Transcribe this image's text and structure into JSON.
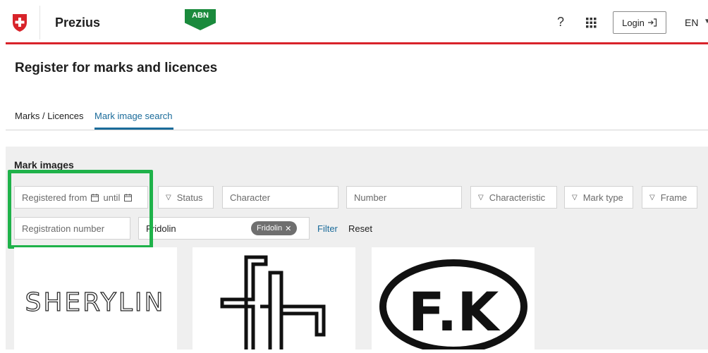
{
  "header": {
    "app_name": "Prezius",
    "env_badge": "ABN",
    "help_label": "?",
    "login_label": "Login",
    "language": "EN"
  },
  "page": {
    "title": "Register for marks and licences",
    "tabs": [
      {
        "label": "Marks / Licences",
        "active": false
      },
      {
        "label": "Mark image search",
        "active": true
      }
    ]
  },
  "filters": {
    "section_title": "Mark images",
    "registered_from": "Registered from",
    "until": "until",
    "status": "Status",
    "character_placeholder": "Character",
    "number_placeholder": "Number",
    "characteristic": "Characteristic",
    "mark_type": "Mark type",
    "frame": "Frame",
    "registration_number_placeholder": "Registration number",
    "search_value": "Fridolin",
    "chip_label": "Fridolin",
    "filter_label": "Filter",
    "reset_label": "Reset"
  },
  "results": {
    "thumb1_text": "SHERYLIN",
    "thumb3_text": "F.K"
  },
  "colors": {
    "brand_red": "#d8232a",
    "accent_blue": "#1a6b9a",
    "badge_green": "#1a8a3c",
    "highlight_green": "#1fb24a"
  }
}
